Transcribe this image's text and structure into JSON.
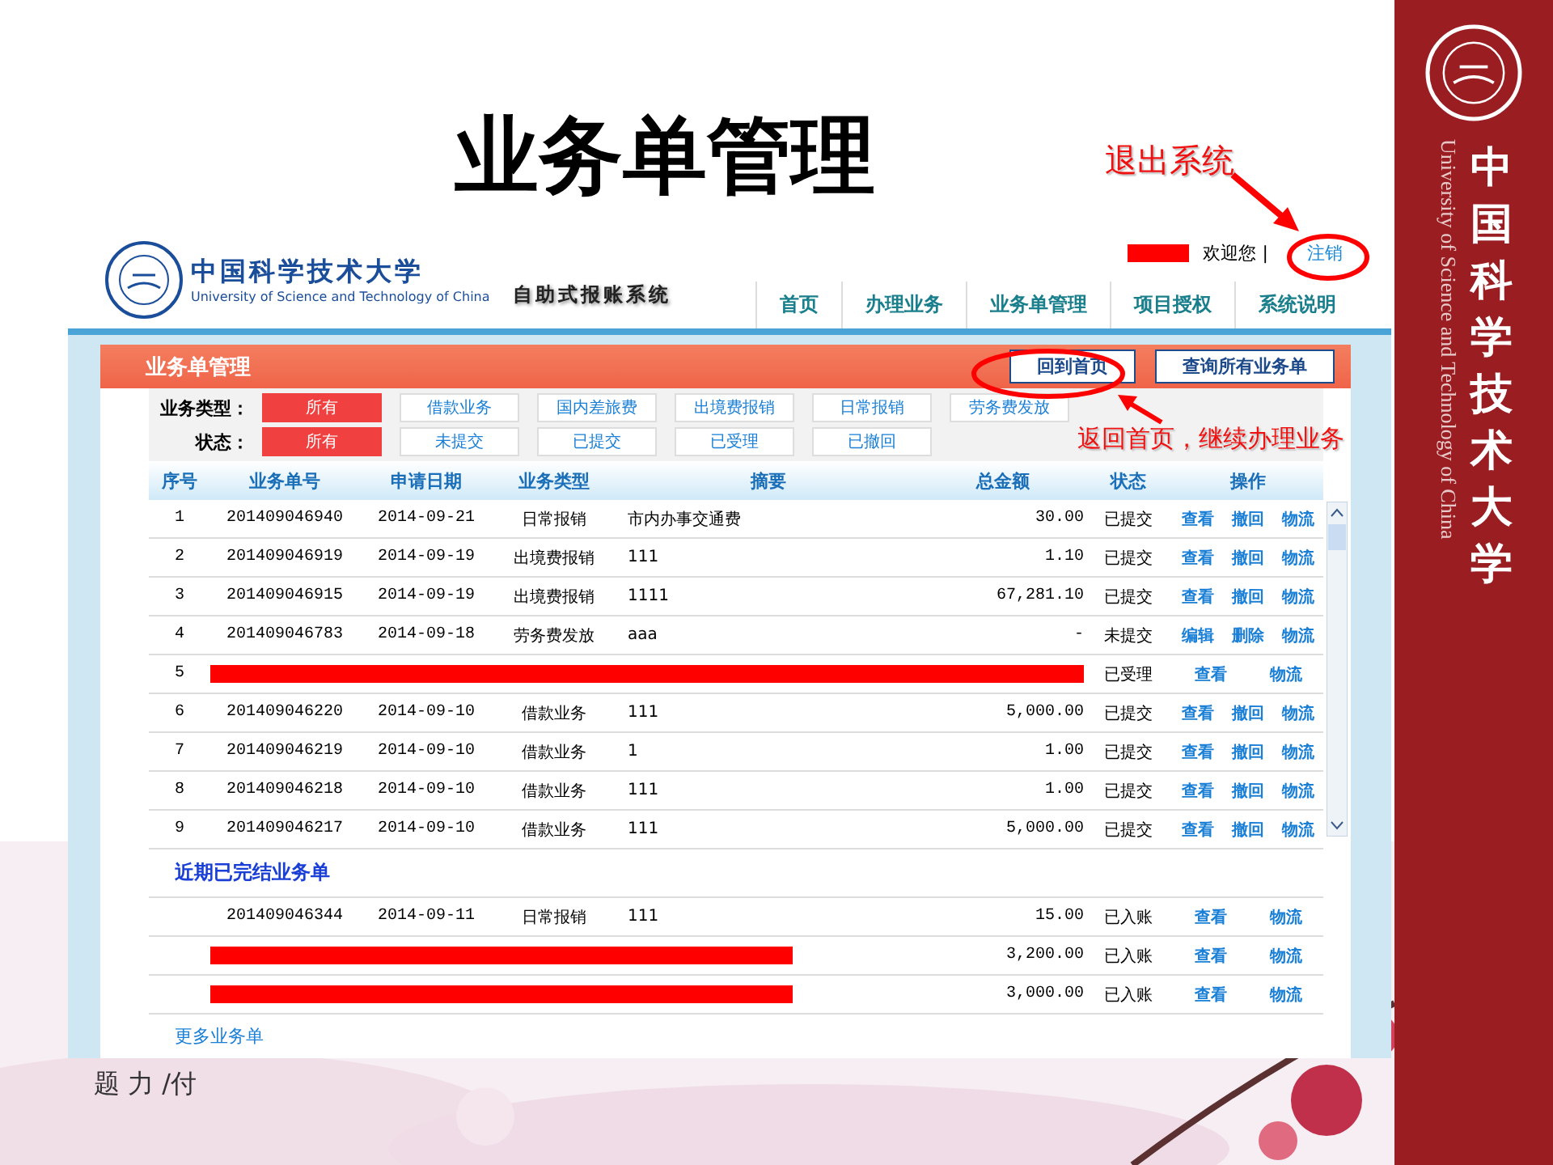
{
  "slide": {
    "title": "业务单管理",
    "footer_text": "题 力 /付"
  },
  "band": {
    "english": "University of Science and Technology of China",
    "chinese": "中国科学技术大学"
  },
  "header": {
    "school_cn": "中国科学技术大学",
    "school_en": "University of Science and Technology of China",
    "system_name": "自助式报账系统",
    "welcome": "欢迎您",
    "separator": "|",
    "logout": "注销",
    "nav": [
      {
        "label": "首页",
        "selected": false
      },
      {
        "label": "办理业务",
        "selected": false
      },
      {
        "label": "业务单管理",
        "selected": false
      },
      {
        "label": "项目授权",
        "selected": false
      },
      {
        "label": "系统说明",
        "selected": false
      }
    ]
  },
  "panel": {
    "title": "业务单管理",
    "buttons": [
      "回到首页",
      "查询所有业务单"
    ]
  },
  "filters": [
    {
      "label": "业务类型：",
      "options": [
        {
          "label": "所有",
          "selected": true
        },
        {
          "label": "借款业务",
          "selected": false
        },
        {
          "label": "国内差旅费",
          "selected": false
        },
        {
          "label": "出境费报销",
          "selected": false
        },
        {
          "label": "日常报销",
          "selected": false
        },
        {
          "label": "劳务费发放",
          "selected": false
        }
      ]
    },
    {
      "label": "状态：",
      "options": [
        {
          "label": "所有",
          "selected": true
        },
        {
          "label": "未提交",
          "selected": false
        },
        {
          "label": "已提交",
          "selected": false
        },
        {
          "label": "已受理",
          "selected": false
        },
        {
          "label": "已撤回",
          "selected": false
        }
      ]
    }
  ],
  "table": {
    "columns": [
      "序号",
      "业务单号",
      "申请日期",
      "业务类型",
      "摘要",
      "总金额",
      "状态",
      "操作"
    ],
    "rows": [
      {
        "kind": "order",
        "seq": "1",
        "number": "201409046940",
        "date": "2014-09-21",
        "type": "日常报销",
        "summary": "市内办事交通费",
        "amount": "30.00",
        "status": "已提交",
        "actions": [
          "查看",
          "撤回",
          "物流"
        ]
      },
      {
        "kind": "order",
        "seq": "2",
        "number": "201409046919",
        "date": "2014-09-19",
        "type": "出境费报销",
        "summary": "111",
        "amount": "1.10",
        "status": "已提交",
        "actions": [
          "查看",
          "撤回",
          "物流"
        ]
      },
      {
        "kind": "order",
        "seq": "3",
        "number": "201409046915",
        "date": "2014-09-19",
        "type": "出境费报销",
        "summary": "1111",
        "amount": "67,281.10",
        "status": "已提交",
        "actions": [
          "查看",
          "撤回",
          "物流"
        ]
      },
      {
        "kind": "order",
        "seq": "4",
        "number": "201409046783",
        "date": "2014-09-18",
        "type": "劳务费发放",
        "summary": "aaa",
        "amount": "-",
        "status": "未提交",
        "actions": [
          "编辑",
          "删除",
          "物流"
        ]
      },
      {
        "kind": "redacted",
        "seq": "5",
        "status": "已受理",
        "actions": [
          "查看",
          "物流"
        ]
      },
      {
        "kind": "order",
        "seq": "6",
        "number": "201409046220",
        "date": "2014-09-10",
        "type": "借款业务",
        "summary": "111",
        "amount": "5,000.00",
        "status": "已提交",
        "actions": [
          "查看",
          "撤回",
          "物流"
        ]
      },
      {
        "kind": "order",
        "seq": "7",
        "number": "201409046219",
        "date": "2014-09-10",
        "type": "借款业务",
        "summary": "1",
        "amount": "1.00",
        "status": "已提交",
        "actions": [
          "查看",
          "撤回",
          "物流"
        ]
      },
      {
        "kind": "order",
        "seq": "8",
        "number": "201409046218",
        "date": "2014-09-10",
        "type": "借款业务",
        "summary": "111",
        "amount": "1.00",
        "status": "已提交",
        "actions": [
          "查看",
          "撤回",
          "物流"
        ]
      },
      {
        "kind": "order",
        "seq": "9",
        "number": "201409046217",
        "date": "2014-09-10",
        "type": "借款业务",
        "summary": "111",
        "amount": "5,000.00",
        "status": "已提交",
        "actions": [
          "查看",
          "撤回",
          "物流"
        ]
      }
    ]
  },
  "completed": {
    "title": "近期已完结业务单",
    "more": "更多业务单",
    "rows": [
      {
        "kind": "order",
        "number": "201409046344",
        "date": "2014-09-11",
        "type": "日常报销",
        "summary": "111",
        "amount": "15.00",
        "status": "已入账",
        "actions": [
          "查看",
          "物流"
        ]
      },
      {
        "kind": "redacted",
        "amount": "3,200.00",
        "status": "已入账",
        "actions": [
          "查看",
          "物流"
        ]
      },
      {
        "kind": "redacted",
        "amount": "3,000.00",
        "status": "已入账",
        "actions": [
          "查看",
          "物流"
        ]
      }
    ]
  },
  "callouts": [
    {
      "text": "退出系统"
    },
    {
      "text": "返回首页，继续办理业务"
    }
  ]
}
